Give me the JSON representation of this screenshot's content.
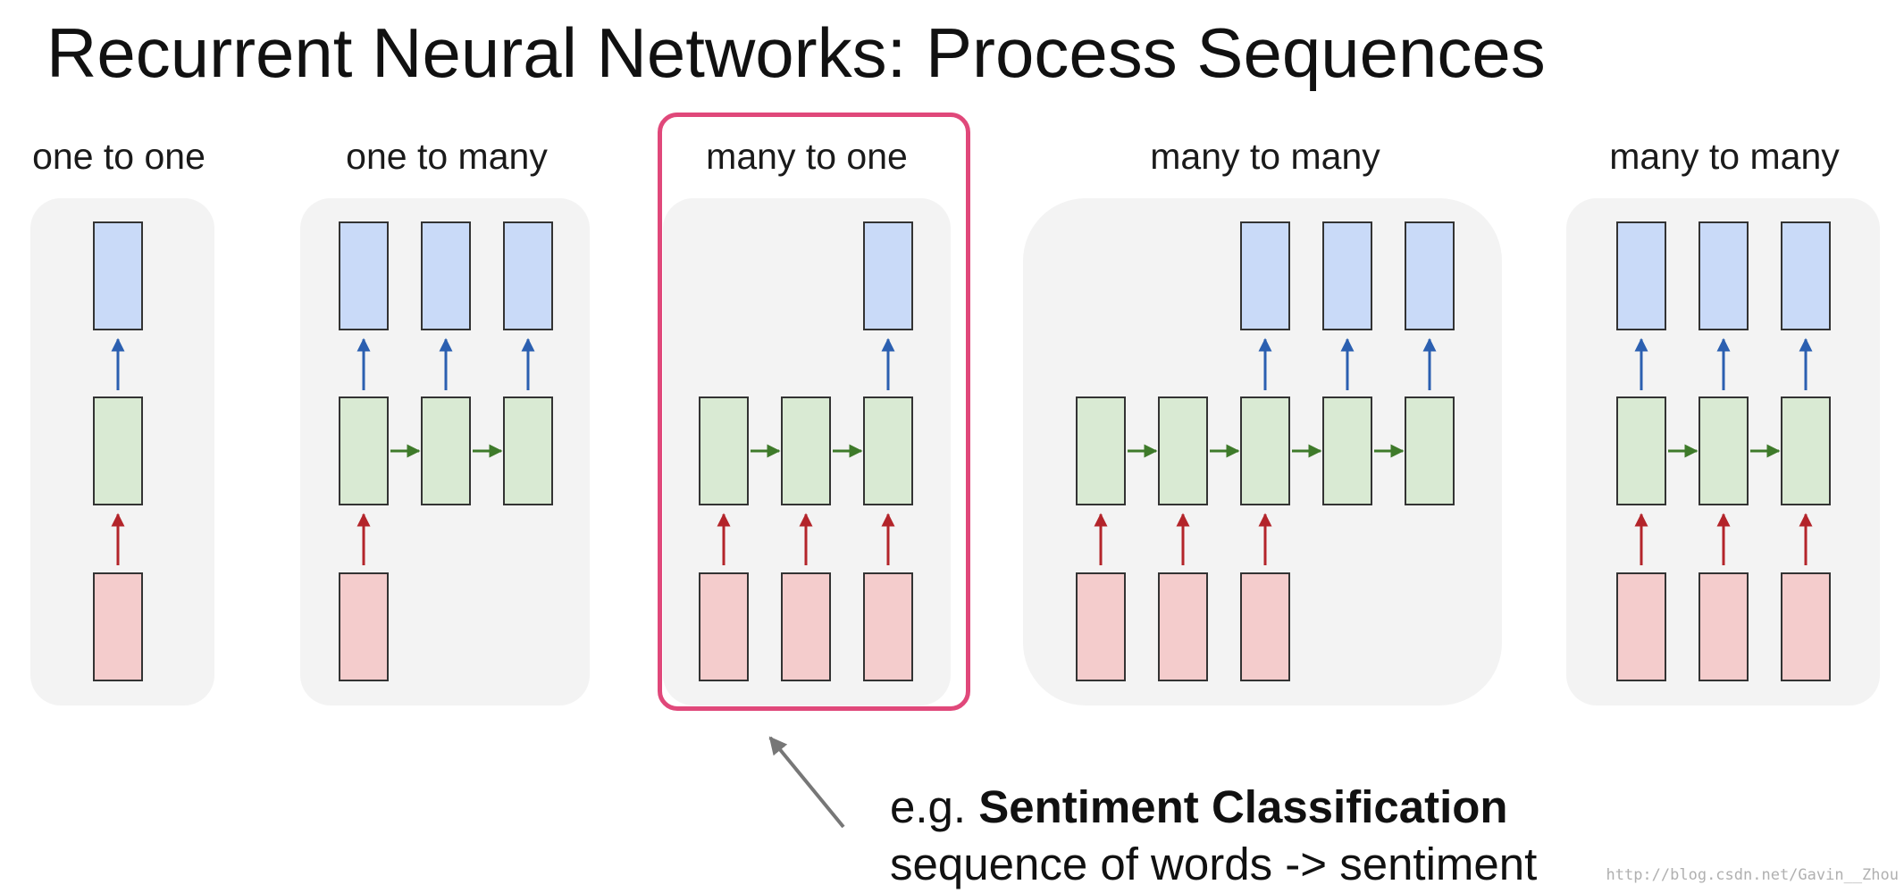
{
  "title": "Recurrent Neural Networks: Process Sequences",
  "groups": [
    {
      "label": "one to one"
    },
    {
      "label": "one to many"
    },
    {
      "label": "many to one"
    },
    {
      "label": "many to many"
    },
    {
      "label": "many to many"
    }
  ],
  "caption": {
    "prefix": "e.g. ",
    "emphasis": "Sentiment Classification",
    "line2": "sequence of words -> sentiment"
  },
  "watermark": "http://blog.csdn.net/Gavin__Zhou",
  "colors": {
    "output_box": "#c9daf8",
    "hidden_box": "#d9ead3",
    "input_box": "#f4cccc",
    "input_arrow": "#b3242a",
    "output_arrow": "#2b5fb0",
    "recurrent_arrow": "#3e7a2a",
    "highlight": "#e0487a"
  }
}
